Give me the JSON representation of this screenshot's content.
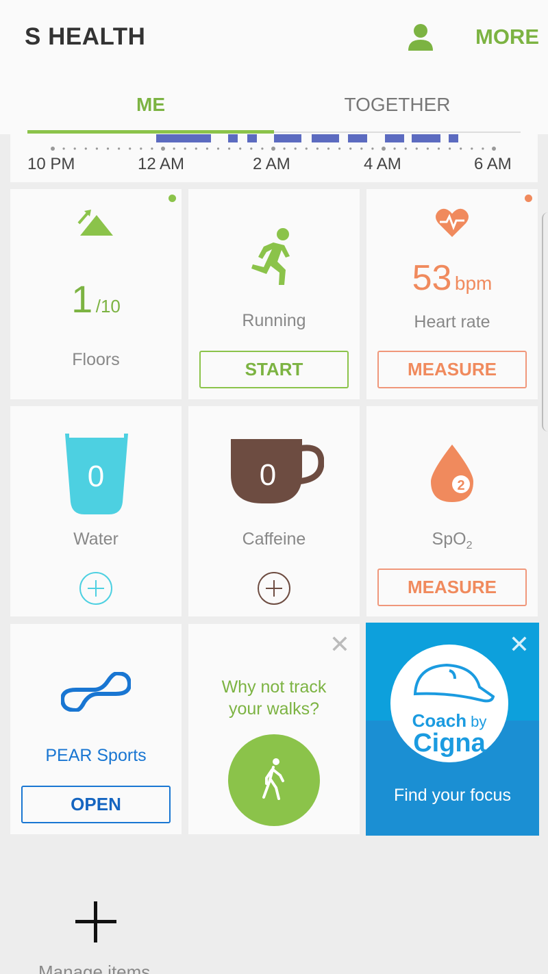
{
  "header": {
    "title": "S HEALTH",
    "more_label": "MORE",
    "profile_icon": "person-icon",
    "accent": "#7cb342"
  },
  "tabs": [
    {
      "label": "ME",
      "active": true
    },
    {
      "label": "TOGETHER",
      "active": false
    }
  ],
  "sleep": {
    "time_labels": [
      "10 PM",
      "12 AM",
      "2 AM",
      "4 AM",
      "6 AM"
    ],
    "bar_color": "#5c6bc0"
  },
  "tiles": {
    "floors": {
      "value": "1",
      "goal": "/10",
      "label": "Floors",
      "icon": "mountain-icon"
    },
    "running": {
      "label": "Running",
      "button": "START",
      "icon": "runner-icon"
    },
    "heart_rate": {
      "value": "53",
      "unit": "bpm",
      "label": "Heart rate",
      "button": "MEASURE",
      "icon": "heart-icon",
      "color": "#f08a5d"
    },
    "water": {
      "value": "0",
      "label": "Water",
      "icon": "glass-icon",
      "color": "#4dd0e1"
    },
    "caffeine": {
      "value": "0",
      "label": "Caffeine",
      "icon": "cup-icon",
      "color": "#6d4c41"
    },
    "spo2": {
      "label_main": "SpO",
      "label_sub": "2",
      "button": "MEASURE",
      "icon": "drop-icon"
    },
    "pear": {
      "label": "PEAR Sports",
      "button": "OPEN",
      "icon": "pear-logo-icon",
      "color": "#1976d2"
    },
    "walks": {
      "line1": "Why not track",
      "line2": "your walks?",
      "icon": "walking-icon"
    },
    "coach": {
      "logo_line1": "Coach",
      "logo_by": "by",
      "logo_line2": "Cigna",
      "tagline": "Find your focus",
      "color": "#0da0dc"
    }
  },
  "manage": {
    "label": "Manage items",
    "icon": "plus-icon"
  }
}
